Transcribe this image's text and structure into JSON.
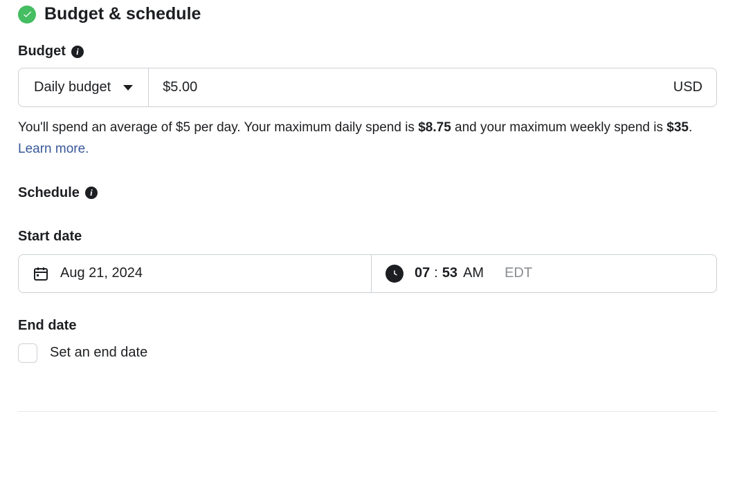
{
  "header": {
    "title": "Budget & schedule"
  },
  "budget": {
    "label": "Budget",
    "type_select": {
      "selected": "Daily budget"
    },
    "amount": "$5.00",
    "currency": "USD",
    "helper": {
      "pre": "You'll spend an average of $5 per day. Your maximum daily spend is ",
      "max_daily": "$8.75",
      "mid": " and your maximum weekly spend is ",
      "max_weekly": "$35",
      "post": ". ",
      "learn_more": "Learn more."
    }
  },
  "schedule": {
    "label": "Schedule",
    "start": {
      "label": "Start date",
      "date": "Aug 21, 2024",
      "time_hour": "07",
      "time_minute": "53",
      "time_ampm": "AM",
      "timezone": "EDT"
    },
    "end": {
      "label": "End date",
      "checkbox_label": "Set an end date"
    }
  }
}
